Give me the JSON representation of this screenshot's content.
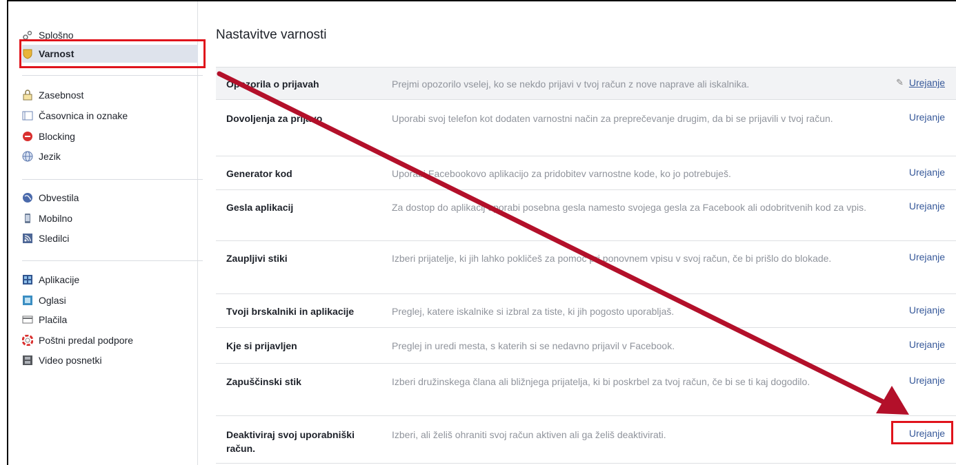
{
  "sidebar": {
    "items": [
      {
        "label": "Splošno",
        "icon": "gears-icon",
        "name": "sidebar-item-general"
      },
      {
        "label": "Varnost",
        "icon": "shield-icon",
        "name": "sidebar-item-security"
      },
      {
        "label": "Zasebnost",
        "icon": "lock-icon",
        "name": "sidebar-item-privacy"
      },
      {
        "label": "Časovnica in oznake",
        "icon": "timeline-icon",
        "name": "sidebar-item-timeline"
      },
      {
        "label": "Blocking",
        "icon": "block-icon",
        "name": "sidebar-item-blocking"
      },
      {
        "label": "Jezik",
        "icon": "globe-icon",
        "name": "sidebar-item-language"
      },
      {
        "label": "Obvestila",
        "icon": "globe-notify-icon",
        "name": "sidebar-item-notifications"
      },
      {
        "label": "Mobilno",
        "icon": "phone-icon",
        "name": "sidebar-item-mobile"
      },
      {
        "label": "Sledilci",
        "icon": "rss-icon",
        "name": "sidebar-item-followers"
      },
      {
        "label": "Aplikacije",
        "icon": "apps-icon",
        "name": "sidebar-item-apps"
      },
      {
        "label": "Oglasi",
        "icon": "ads-icon",
        "name": "sidebar-item-ads"
      },
      {
        "label": "Plačila",
        "icon": "card-icon",
        "name": "sidebar-item-payments"
      },
      {
        "label": "Poštni predal podpore",
        "icon": "lifebuoy-icon",
        "name": "sidebar-item-support-inbox"
      },
      {
        "label": "Video posnetki",
        "icon": "film-icon",
        "name": "sidebar-item-videos"
      }
    ]
  },
  "main": {
    "title": "Nastavitve varnosti",
    "rows": [
      {
        "label": "Opozorila o prijavah",
        "desc": "Prejmi opozorilo vselej, ko se nekdo prijavi v tvoj račun z nove naprave ali iskalnika.",
        "edit": "Urejanje"
      },
      {
        "label": "Dovoljenja za prijavo",
        "desc": "Uporabi svoj telefon kot dodaten varnostni način za preprečevanje drugim, da bi se prijavili v tvoj račun.",
        "edit": "Urejanje"
      },
      {
        "label": "Generator kod",
        "desc": "Uporabi Facebookovo aplikacijo za pridobitev varnostne kode, ko jo potrebuješ.",
        "edit": "Urejanje"
      },
      {
        "label": "Gesla aplikacij",
        "desc": "Za dostop do aplikacij uporabi posebna gesla namesto svojega gesla za Facebook ali odobritvenih kod za vpis.",
        "edit": "Urejanje"
      },
      {
        "label": "Zaupljivi stiki",
        "desc": "Izberi prijatelje, ki jih lahko pokličeš za pomoč pri ponovnem vpisu v svoj račun, če bi prišlo do blokade.",
        "edit": "Urejanje"
      },
      {
        "label": "Tvoji brskalniki in aplikacije",
        "desc": "Preglej, katere iskalnike si izbral za tiste, ki jih pogosto uporabljaš.",
        "edit": "Urejanje"
      },
      {
        "label": "Kje si prijavljen",
        "desc": "Preglej in uredi mesta, s katerih si se nedavno prijavil v Facebook.",
        "edit": "Urejanje"
      },
      {
        "label": "Zapuščinski stik",
        "desc": "Izberi družinskega člana ali bližnjega prijatelja, ki bi poskrbel za tvoj račun, če bi se ti kaj dogodilo.",
        "edit": "Urejanje"
      },
      {
        "label": "Deaktiviraj svoj uporabniški račun.",
        "desc": "Izberi, ali želiš ohraniti svoj račun aktiven ali ga želiš deaktivirati.",
        "edit": "Urejanje"
      }
    ]
  },
  "colors": {
    "link": "#365899",
    "highlight": "#e0131b",
    "arrow": "#b3102a"
  }
}
